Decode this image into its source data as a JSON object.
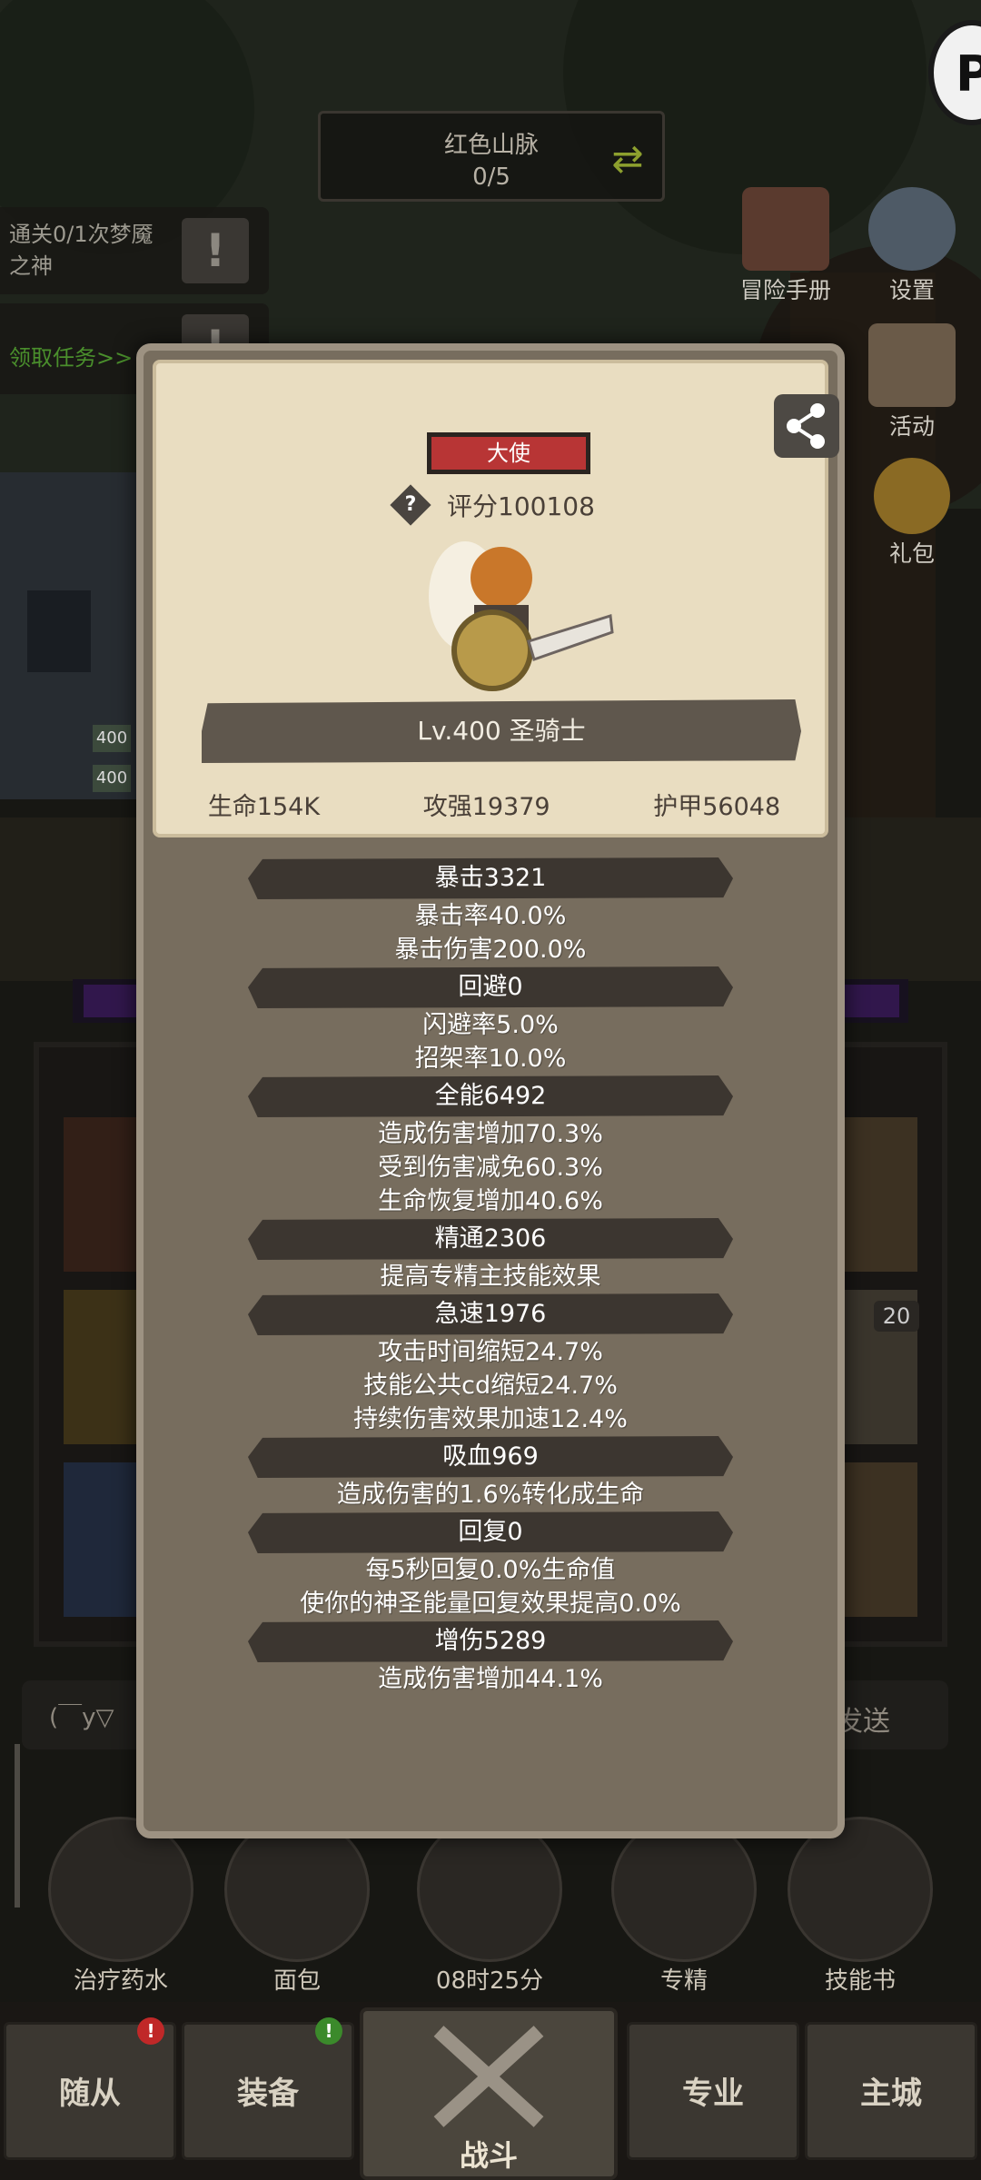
{
  "colors": {
    "accent_red": "#b83535",
    "panel": "#776d5e",
    "card": "#e9ddc1",
    "quest_green": "#4a8f2c"
  },
  "region": {
    "name": "红色山脉",
    "progress": "0/5"
  },
  "quests": [
    {
      "text": "通关0/1次梦魇之神",
      "icon": "exclamation-icon"
    },
    {
      "text": "领取任务>>",
      "icon": "exclamation-icon"
    }
  ],
  "side_buttons": [
    {
      "label": "冒险手册",
      "icon": "book-icon"
    },
    {
      "label": "设置",
      "icon": "gear-icon"
    },
    {
      "label": "活动",
      "icon": "scroll-icon"
    },
    {
      "label": "礼包",
      "icon": "coin-icon"
    }
  ],
  "background": {
    "unit_level_a": "400",
    "unit_level_b": "400",
    "slot_count": "20",
    "chat_prefix": "(￣y▽",
    "chat_send": "发送"
  },
  "bottom_items": [
    {
      "label": "治疗药水",
      "icon": "potion-icon"
    },
    {
      "label": "面包",
      "icon": "bread-icon"
    },
    {
      "label": "08时25分",
      "icon": "chest-icon"
    },
    {
      "label": "专精",
      "icon": "swap-icon"
    },
    {
      "label": "技能书",
      "icon": "skill-book-icon"
    }
  ],
  "nav": {
    "tab1": "随从",
    "tab2": "装备",
    "battle": "战斗",
    "tab3": "专业",
    "tab4": "主城"
  },
  "modal": {
    "rank": "大使",
    "score": "评分100108",
    "level": "Lv.400 圣骑士",
    "core_stats": [
      "生命154K",
      "攻强19379",
      "护甲56048"
    ],
    "groups": [
      {
        "header": "暴击3321",
        "lines": [
          "暴击率40.0%",
          "暴击伤害200.0%"
        ]
      },
      {
        "header": "回避0",
        "lines": [
          "闪避率5.0%",
          "招架率10.0%"
        ]
      },
      {
        "header": "全能6492",
        "lines": [
          "造成伤害增加70.3%",
          "受到伤害减免60.3%",
          "生命恢复增加40.6%"
        ]
      },
      {
        "header": "精通2306",
        "lines": [
          "提高专精主技能效果"
        ]
      },
      {
        "header": "急速1976",
        "lines": [
          "攻击时间缩短24.7%",
          "技能公共cd缩短24.7%",
          "持续伤害效果加速12.4%"
        ]
      },
      {
        "header": "吸血969",
        "lines": [
          "造成伤害的1.6%转化成生命"
        ]
      },
      {
        "header": "回复0",
        "lines": [
          "每5秒回复0.0%生命值",
          "使你的神圣能量回复效果提高0.0%"
        ]
      },
      {
        "header": "增伤5289",
        "lines": [
          "造成伤害增加44.1%"
        ]
      }
    ]
  }
}
